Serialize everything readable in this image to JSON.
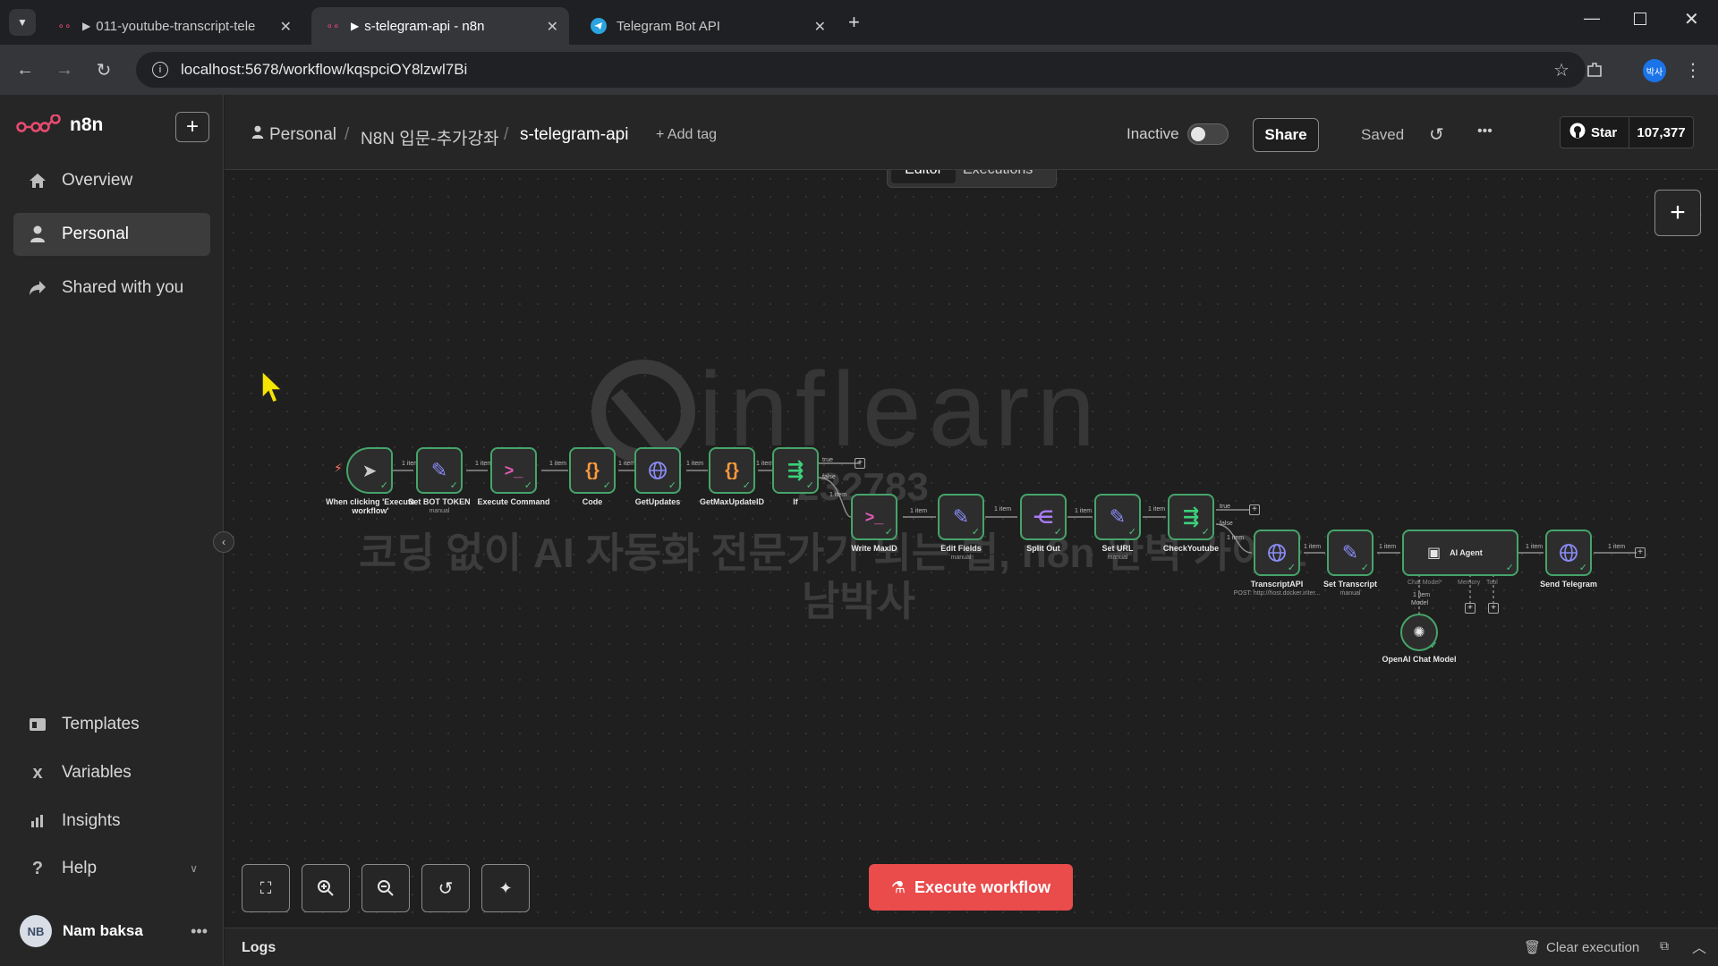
{
  "browser": {
    "tabs": [
      {
        "title": "011-youtube-transcript-tele",
        "active": false
      },
      {
        "title": "s-telegram-api - n8n",
        "active": true
      },
      {
        "title": "Telegram Bot API",
        "active": false
      }
    ],
    "url": "localhost:5678/workflow/kqspciOY8lzwl7Bi",
    "profile_initials": "박사"
  },
  "sidebar": {
    "brand": "n8n",
    "items": [
      {
        "label": "Overview",
        "icon": "home-icon"
      },
      {
        "label": "Personal",
        "icon": "user-icon",
        "active": true
      },
      {
        "label": "Shared with you",
        "icon": "share-icon"
      }
    ],
    "bottom_items": [
      {
        "label": "Templates",
        "icon": "templates-icon"
      },
      {
        "label": "Variables",
        "icon": "variables-icon"
      },
      {
        "label": "Insights",
        "icon": "insights-icon"
      },
      {
        "label": "Help",
        "icon": "help-icon"
      }
    ],
    "user": {
      "initials": "NB",
      "name": "Nam baksa"
    }
  },
  "header": {
    "breadcrumbs": [
      "Personal",
      "N8N 입문-추가강좌",
      "s-telegram-api"
    ],
    "add_tag": "+ Add tag",
    "status_label": "Inactive",
    "share_label": "Share",
    "saved_label": "Saved",
    "star_label": "Star",
    "star_count": "107,377",
    "tabs": [
      "Editor",
      "Executions"
    ],
    "active_tab": "Editor"
  },
  "watermark": {
    "logo": "inflearn",
    "id": "232783",
    "line1": "코딩 없이 AI 자동화 전문가가 되는 법, n8n 완벽 가이드",
    "line2": "남박사"
  },
  "workflow": {
    "nodes": [
      {
        "name": "When clicking 'Execute workflow'",
        "sub": "",
        "icon": "cursor-icon"
      },
      {
        "name": "Set BOT TOKEN",
        "sub": "manual",
        "icon": "pencil-icon"
      },
      {
        "name": "Execute Command",
        "sub": "",
        "icon": "terminal-icon"
      },
      {
        "name": "Code",
        "sub": "",
        "icon": "code-icon"
      },
      {
        "name": "GetUpdates",
        "sub": "",
        "icon": "globe-icon"
      },
      {
        "name": "GetMaxUpdateID",
        "sub": "",
        "icon": "code-icon"
      },
      {
        "name": "If",
        "sub": "",
        "icon": "if-icon"
      },
      {
        "name": "Write MaxID",
        "sub": "",
        "icon": "terminal-icon"
      },
      {
        "name": "Edit Fields",
        "sub": "manual",
        "icon": "pencil-icon"
      },
      {
        "name": "Split Out",
        "sub": "",
        "icon": "split-icon"
      },
      {
        "name": "Set URL",
        "sub": "manual",
        "icon": "pencil-icon"
      },
      {
        "name": "CheckYoutube",
        "sub": "",
        "icon": "if-icon"
      },
      {
        "name": "TranscriptAPI",
        "sub": "POST: http://host.docker.inter...",
        "icon": "globe-icon"
      },
      {
        "name": "Set Transcript",
        "sub": "manual",
        "icon": "pencil-icon"
      },
      {
        "name": "AI Agent",
        "sub": "",
        "icon": "robot-icon"
      },
      {
        "name": "Send Telegram",
        "sub": "",
        "icon": "globe-icon"
      },
      {
        "name": "OpenAI Chat Model",
        "sub": "",
        "icon": "openai-icon"
      }
    ],
    "edge_label": "1 item",
    "true_label": "true",
    "false_label": "false",
    "agent_ports": [
      "Chat Model*",
      "Memory",
      "Tool"
    ],
    "model_label": "Model"
  },
  "execute_label": "Execute workflow",
  "logs": {
    "label": "Logs",
    "clear_label": "Clear execution"
  }
}
